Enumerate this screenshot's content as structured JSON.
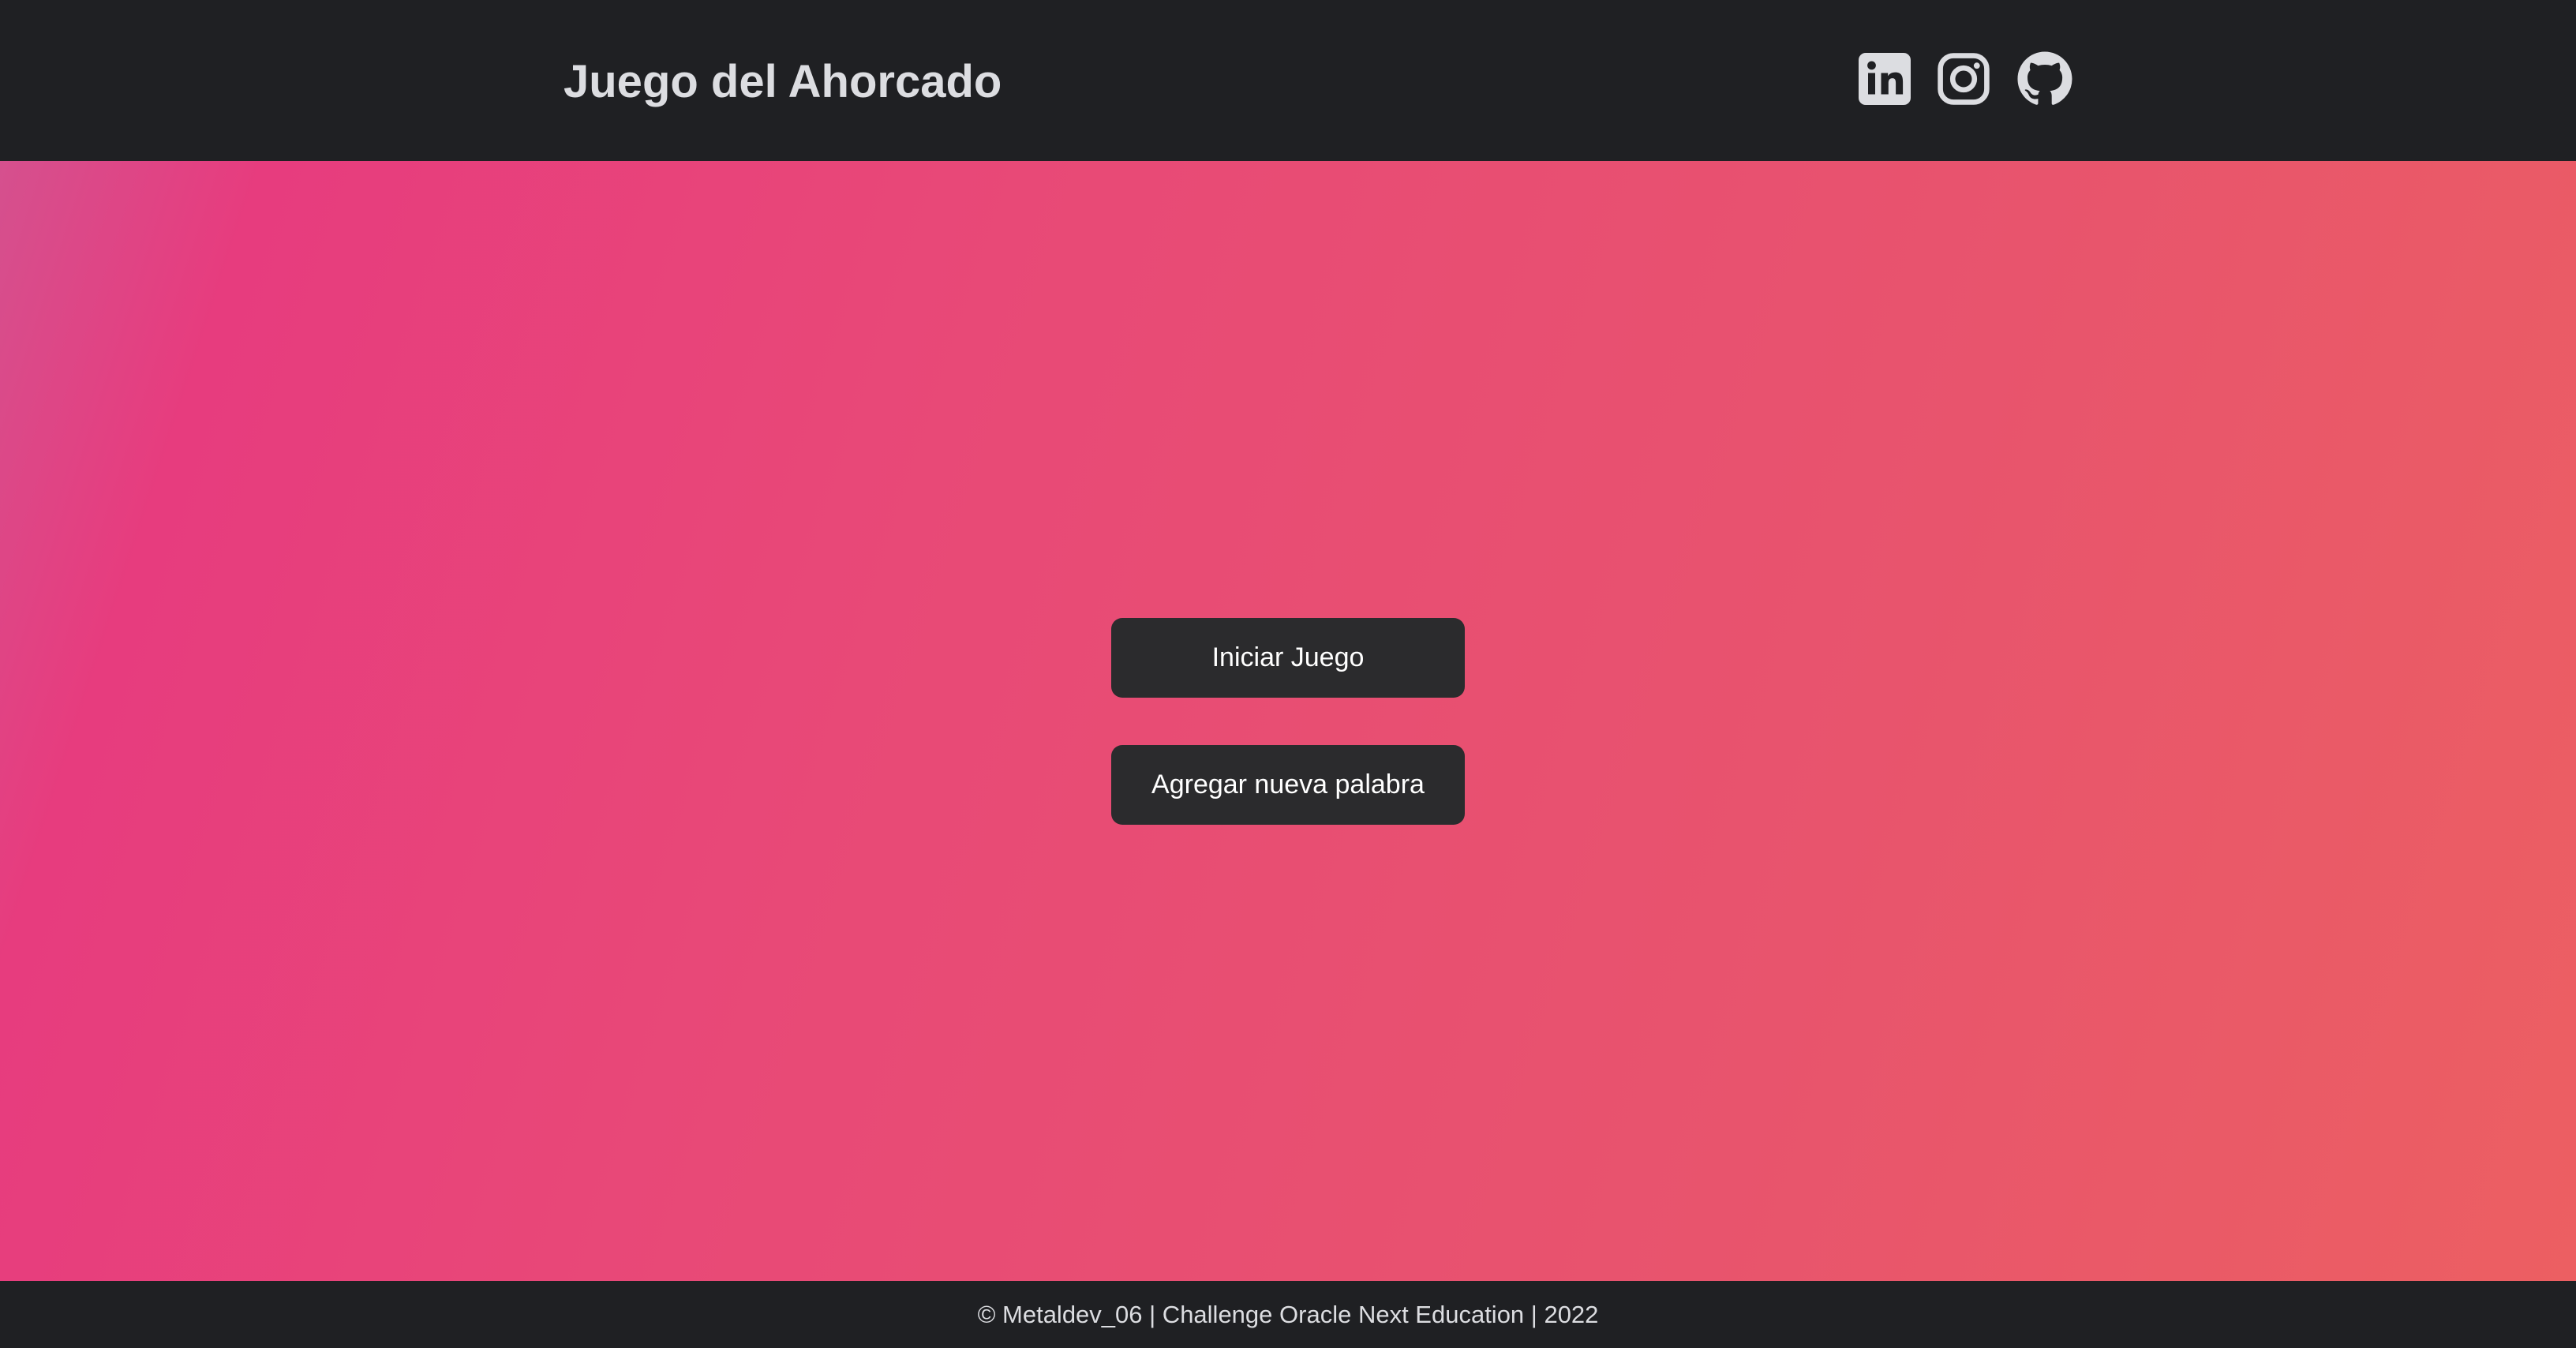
{
  "header": {
    "title": "Juego del Ahorcado",
    "social": [
      {
        "icon": "linkedin-icon"
      },
      {
        "icon": "instagram-icon"
      },
      {
        "icon": "github-icon"
      }
    ]
  },
  "main": {
    "start_button": "Iniciar Juego",
    "add_word_button": "Agregar nueva palabra"
  },
  "footer": {
    "text": "© Metaldev_06 | Challenge Oracle Next Education | 2022"
  },
  "colors": {
    "header_bg": "#1f2023",
    "header_text": "#dcdde1",
    "gradient_start": "#e73c7e",
    "gradient_end": "#ec5f62",
    "button_bg": "#2b2b2d",
    "button_text": "#ffffff"
  }
}
